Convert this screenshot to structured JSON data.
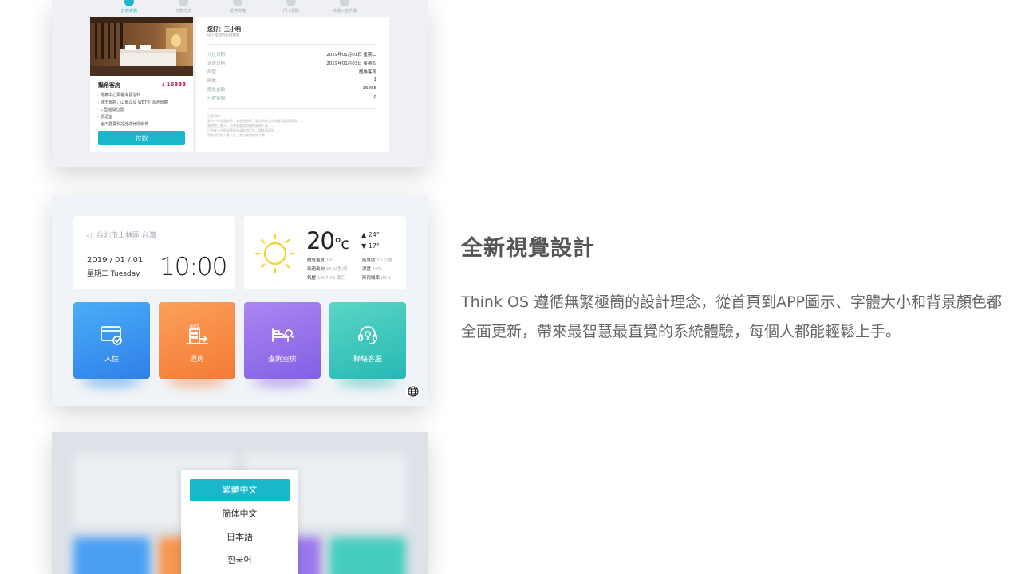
{
  "booking": {
    "steps": [
      "訂房資訊",
      "付款方式",
      "證件掃描",
      "門卡領取",
      "完成入住手續"
    ],
    "room": {
      "name": "豔角客房",
      "currency": "$",
      "price": "16888",
      "features": [
        "· 芳療中心風格海島浴缸",
        "· 城市景觀，山景以及 WET® 泳池景觀",
        "· L 型邊間位置",
        "· 調酒室",
        "· 室內露臺和設舒適休閒躺椅"
      ],
      "pay_label": "付款"
    },
    "greeting": "您好：王小明",
    "greeting_sub": "以下是您的訂房資訊",
    "details": [
      {
        "label": "入住日期",
        "value": "2019年01月01日 星期二"
      },
      {
        "label": "退房日期",
        "value": "2019年01月03日 星期四"
      },
      {
        "label": "房型",
        "value": "豔角客房"
      },
      {
        "label": "間數",
        "value": "1"
      },
      {
        "label": "應收金額",
        "value": "16888"
      },
      {
        "label": "已收金額",
        "value": "0"
      }
    ],
    "notice": [
      "注意須知：",
      "室內一律全面禁菸，若違規吸菸，飯店將依法向旅客索取清潔費……",
      "寵物禁止攜入，若有需要請洽櫃檯服務人員……",
      "訂房後入住前如需更改或取消訂房，請來電通知……",
      "請依照訂房人數入住，禁止攜帶額外人數。"
    ]
  },
  "home": {
    "location": "台北市士林區 台灣",
    "date": "2019 / 01 / 01",
    "weekday": "星期二  Tuesday",
    "time": "10:00",
    "weather": {
      "temp": "20",
      "unit": "°c",
      "high": "▲ 24°",
      "low": "▼ 17°",
      "rows": [
        {
          "k": "體感溫度",
          "v": "19°",
          "k2": "能見度",
          "v2": "10 公里"
        },
        {
          "k": "風速風向",
          "v": "30 公里/時",
          "k2": "濕度",
          "v2": "59%"
        },
        {
          "k": "氣壓",
          "v": "1007.00 毫巴",
          "k2": "降雨機率",
          "v2": "80%"
        }
      ],
      "sun_color": "#f5d132"
    },
    "tiles": [
      {
        "label": "入住",
        "icon": "card-checkin-icon",
        "from": "#2f8ff0",
        "to": "#4aaef8"
      },
      {
        "label": "退房",
        "icon": "hotel-checkout-icon",
        "from": "#f6823a",
        "to": "#fba05a"
      },
      {
        "label": "查詢空房",
        "icon": "bed-search-icon",
        "from": "#8a63e6",
        "to": "#ab86f2"
      },
      {
        "label": "聯絡客服",
        "icon": "headset-icon",
        "from": "#2cc1b3",
        "to": "#5ad6c5"
      }
    ]
  },
  "language_menu": {
    "options": [
      "繁體中文",
      "简体中文",
      "日本語",
      "한국어"
    ],
    "selected": "繁體中文"
  },
  "feature": {
    "headline": "全新視覺設計",
    "description": "Think OS 遵循無繁極簡的設計理念，從首頁到APP圖示、字體大小和背景顏色都全面更新，帶來最智慧最直覺的系統體驗，每個人都能輕鬆上手。"
  },
  "colors": {
    "accent": "#19b7c9",
    "price": "#c2185b"
  }
}
